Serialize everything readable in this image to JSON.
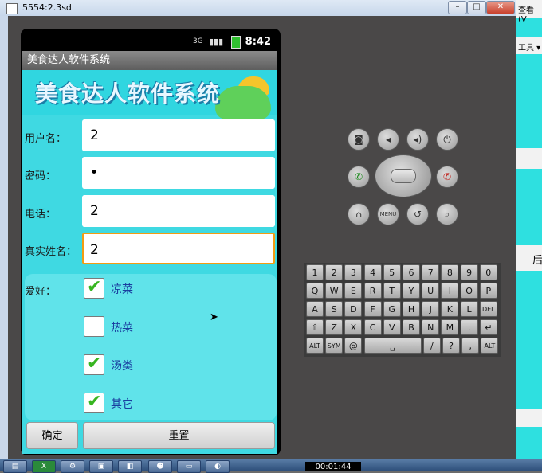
{
  "window": {
    "title": "5554:2.3sd",
    "minimize": "–",
    "maximize": "□",
    "close": "✕"
  },
  "background_app": {
    "menu_top": "查看(V",
    "menu_tools": "工具 ▾",
    "side_char": "后"
  },
  "status_bar": {
    "network": "3G",
    "time": "8:42"
  },
  "app": {
    "title": "美食达人软件系统",
    "banner": "美食达人软件系统",
    "fields": [
      {
        "label": "用户名：",
        "value": "2"
      },
      {
        "label": "密码：",
        "value": "•"
      },
      {
        "label": "电话：",
        "value": "2"
      },
      {
        "label": "真实姓名：",
        "value": "2"
      }
    ],
    "hobby_label": "爱好：",
    "hobbies": [
      {
        "label": "凉菜",
        "checked": true
      },
      {
        "label": "热菜",
        "checked": false
      },
      {
        "label": "汤类",
        "checked": true
      },
      {
        "label": "其它",
        "checked": true
      }
    ],
    "confirm_button": "确定",
    "reset_button": "重置"
  },
  "controls": {
    "camera": "camera-icon",
    "volume_down": "volume-down-icon",
    "volume_up": "volume-up-icon",
    "power": "power-icon",
    "call": "call-icon",
    "end_call": "end-call-icon",
    "home": "home-icon",
    "menu": "MENU",
    "back": "back-icon",
    "search": "search-icon"
  },
  "keyboard": {
    "row1": [
      "1",
      "2",
      "3",
      "4",
      "5",
      "6",
      "7",
      "8",
      "9",
      "0"
    ],
    "row2": [
      "Q",
      "W",
      "E",
      "R",
      "T",
      "Y",
      "U",
      "I",
      "O",
      "P"
    ],
    "row3": [
      "A",
      "S",
      "D",
      "F",
      "G",
      "H",
      "J",
      "K",
      "L",
      "DEL"
    ],
    "row4": [
      "⇧",
      "Z",
      "X",
      "C",
      "V",
      "B",
      "N",
      "M",
      ".",
      "↵"
    ],
    "row5": [
      "ALT",
      "SYM",
      "@",
      "␣",
      "/",
      "?",
      ",",
      "ALT"
    ]
  },
  "taskbar": {
    "timer": "00:01:44"
  }
}
